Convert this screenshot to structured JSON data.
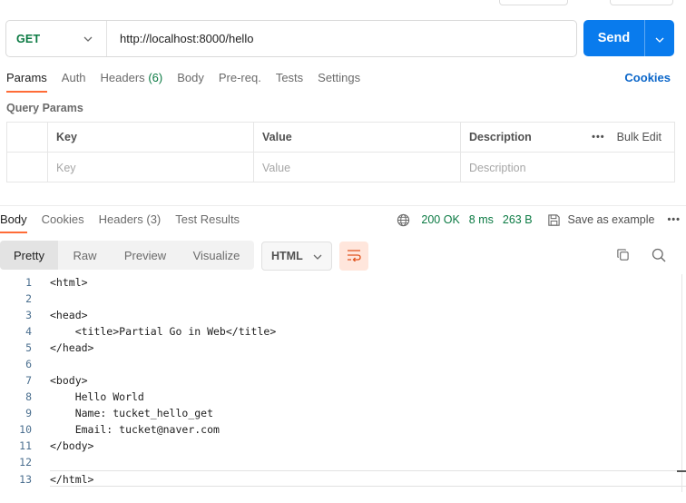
{
  "request": {
    "method": "GET",
    "url": "http://localhost:8000/hello",
    "send_label": "Send",
    "tabs": [
      {
        "label": "Params",
        "count": ""
      },
      {
        "label": "Auth",
        "count": ""
      },
      {
        "label": "Headers",
        "count": "(6)"
      },
      {
        "label": "Body",
        "count": ""
      },
      {
        "label": "Pre-req.",
        "count": ""
      },
      {
        "label": "Tests",
        "count": ""
      },
      {
        "label": "Settings",
        "count": ""
      }
    ],
    "cookies_label": "Cookies",
    "query_params": {
      "title": "Query Params",
      "headers": {
        "key": "Key",
        "value": "Value",
        "description": "Description"
      },
      "bulk_edit": "Bulk Edit",
      "placeholders": {
        "key": "Key",
        "value": "Value",
        "description": "Description"
      }
    }
  },
  "response": {
    "tabs": [
      {
        "label": "Body"
      },
      {
        "label": "Cookies"
      },
      {
        "label": "Headers (3)"
      },
      {
        "label": "Test Results"
      }
    ],
    "status": "200 OK",
    "time": "8 ms",
    "size": "263 B",
    "save_label": "Save as example",
    "formats": [
      "Pretty",
      "Raw",
      "Preview",
      "Visualize"
    ],
    "language": "HTML",
    "lines": [
      {
        "n": "1",
        "text": "<html>"
      },
      {
        "n": "2",
        "text": ""
      },
      {
        "n": "3",
        "text": "<head>"
      },
      {
        "n": "4",
        "text": "    <title>Partial Go in Web</title>"
      },
      {
        "n": "5",
        "text": "</head>"
      },
      {
        "n": "6",
        "text": ""
      },
      {
        "n": "7",
        "text": "<body>"
      },
      {
        "n": "8",
        "text": "    Hello World"
      },
      {
        "n": "9",
        "text": "    Name: tucket_hello_get"
      },
      {
        "n": "10",
        "text": "    Email: tucket@naver.com"
      },
      {
        "n": "11",
        "text": "</body>"
      },
      {
        "n": "12",
        "text": ""
      },
      {
        "n": "13",
        "text": "</html>"
      }
    ]
  },
  "colors": {
    "accent": "#ff6c37",
    "send": "#097bed",
    "method_get": "#0b7a43",
    "link": "#0b66c9"
  }
}
